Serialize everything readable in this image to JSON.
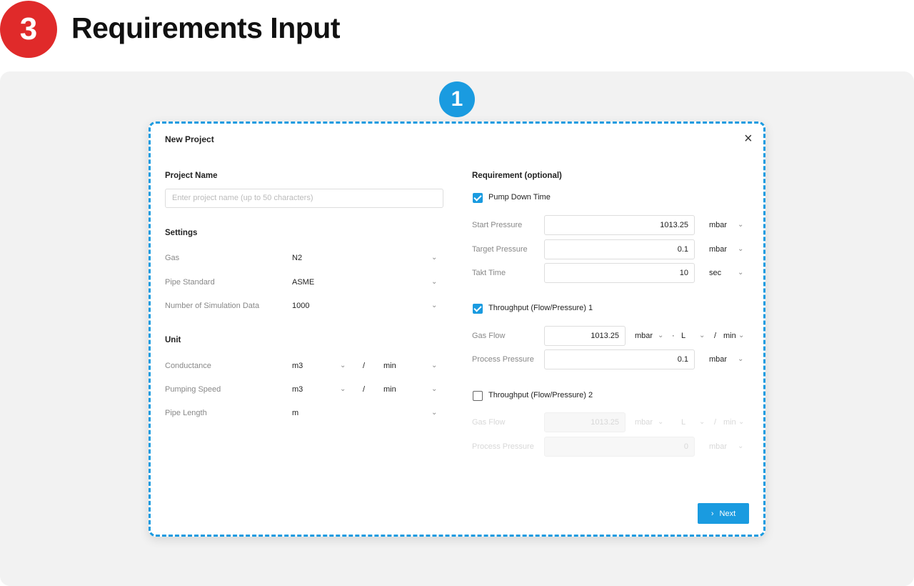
{
  "header": {
    "step": "3",
    "title": "Requirements Input"
  },
  "callout": "1",
  "dialog": {
    "title": "New Project",
    "close_icon": "×",
    "project_name": {
      "label": "Project Name",
      "placeholder": "Enter project name (up to 50 characters)"
    },
    "settings": {
      "title": "Settings",
      "gas": {
        "label": "Gas",
        "value": "N2"
      },
      "pipe_standard": {
        "label": "Pipe Standard",
        "value": "ASME"
      },
      "sim_data": {
        "label": "Number of Simulation Data",
        "value": "1000"
      }
    },
    "unit": {
      "title": "Unit",
      "separator": "/",
      "conductance": {
        "label": "Conductance",
        "unit1": "m3",
        "unit2": "min"
      },
      "pumping_speed": {
        "label": "Pumping Speed",
        "unit1": "m3",
        "unit2": "min"
      },
      "pipe_length": {
        "label": "Pipe Length",
        "unit": "m"
      }
    },
    "requirement": {
      "title": "Requirement (optional)",
      "pump_down": {
        "label": "Pump Down Time",
        "checked": true,
        "start_pressure": {
          "label": "Start Pressure",
          "value": "1013.25",
          "unit": "mbar"
        },
        "target_pressure": {
          "label": "Target Pressure",
          "value": "0.1",
          "unit": "mbar"
        },
        "takt_time": {
          "label": "Takt Time",
          "value": "10",
          "unit": "sec"
        }
      },
      "throughput1": {
        "label": "Throughput (Flow/Pressure) 1",
        "checked": true,
        "gas_flow": {
          "label": "Gas Flow",
          "value": "1013.25",
          "unit1": "mbar",
          "dot": "·",
          "unit2": "L",
          "slash": "/",
          "unit3": "min"
        },
        "process_pressure": {
          "label": "Process Pressure",
          "value": "0.1",
          "unit": "mbar"
        }
      },
      "throughput2": {
        "label": "Throughput (Flow/Pressure) 2",
        "checked": false,
        "gas_flow": {
          "label": "Gas Flow",
          "value": "1013.25",
          "unit1": "mbar",
          "unit2": "L",
          "slash": "/",
          "unit3": "min"
        },
        "process_pressure": {
          "label": "Process Pressure",
          "value": "0",
          "unit": "mbar"
        }
      }
    },
    "next_button": {
      "chevron": "›",
      "label": "Next"
    }
  },
  "colors": {
    "accent": "#1a9be0",
    "step_badge": "#e02a2a"
  },
  "icons": {
    "dropdown": "chevron-down-icon",
    "close": "close-icon",
    "check": "check-icon"
  }
}
